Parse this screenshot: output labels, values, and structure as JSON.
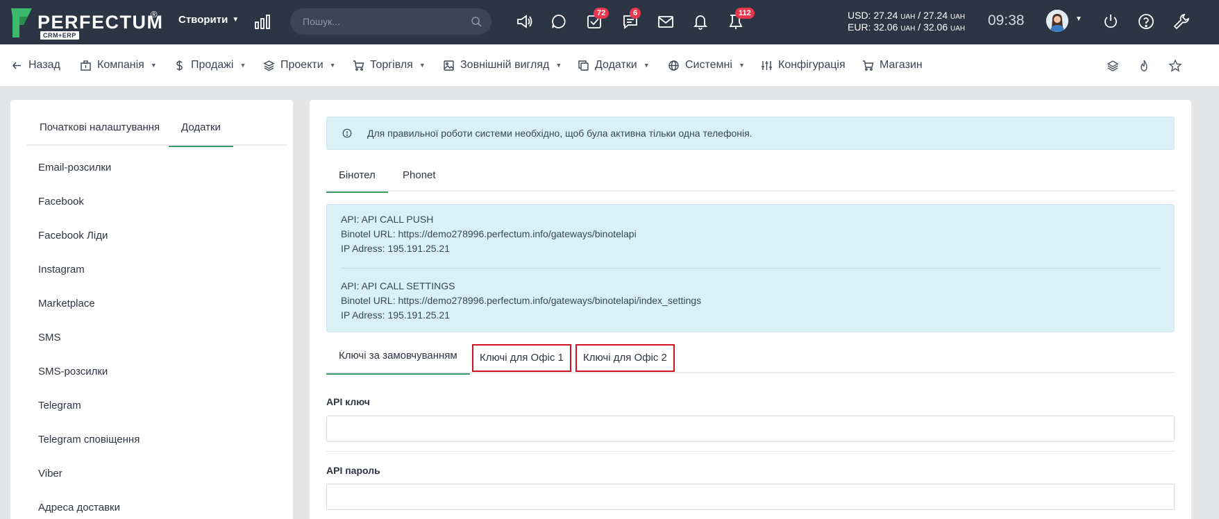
{
  "app": {
    "logo_text": "PERFECTUM",
    "logo_reg": "®",
    "logo_sub": "CRM+ERP",
    "create_label": "Створити",
    "search_placeholder": "Пошук...",
    "badges": {
      "tasks": "72",
      "chat": "6",
      "reminders": "112"
    },
    "rates": {
      "usd_label": "USD:",
      "usd_buy": "27.24",
      "usd_sell": "27.24",
      "eur_label": "EUR:",
      "eur_buy": "32.06",
      "eur_sell": "32.06",
      "currency": "UAH",
      "sep": "/"
    },
    "time": "09:38"
  },
  "nav": {
    "back": "Назад",
    "company": "Компанія",
    "sales": "Продажі",
    "projects": "Проекти",
    "trade": "Торгівля",
    "appearance": "Зовнішній вигляд",
    "addons": "Додатки",
    "system": "Системні",
    "config": "Конфігурація",
    "shop": "Магазин"
  },
  "sidebar": {
    "tabs": [
      "Початкові налаштування",
      "Додатки"
    ],
    "items": [
      "Email-розсилки",
      "Facebook",
      "Facebook Ліди",
      "Instagram",
      "Marketplace",
      "SMS",
      "SMS-розсилки",
      "Telegram",
      "Telegram сповіщення",
      "Viber",
      "Адреса доставки"
    ]
  },
  "main": {
    "alert": "Для правильної роботи системи необхідно, щоб була активна тільки одна телефонія.",
    "provider_tabs": [
      "Бінотел",
      "Phonet"
    ],
    "api_blocks": [
      {
        "api": "API: API CALL PUSH",
        "url": "Binotel URL: https://demo278996.perfectum.info/gateways/binotelapi",
        "ip": "IP Adress: 195.191.25.21"
      },
      {
        "api": "API: API CALL SETTINGS",
        "url": "Binotel URL: https://demo278996.perfectum.info/gateways/binotelapi/index_settings",
        "ip": "IP Adress: 195.191.25.21"
      }
    ],
    "key_tabs": [
      "Ключі за замовчуванням",
      "Ключі для Офіс 1",
      "Ключі для Офіс 2"
    ],
    "fields": [
      {
        "label": "API ключ",
        "value": ""
      },
      {
        "label": "API пароль",
        "value": ""
      }
    ]
  },
  "colors": {
    "topbar": "#2b3544",
    "accent": "#3d9b6a",
    "badge": "#e8384f",
    "info_bg": "#daf0f6",
    "highlight_box": "#d0101f",
    "logo_green": "#3dbb6c"
  }
}
